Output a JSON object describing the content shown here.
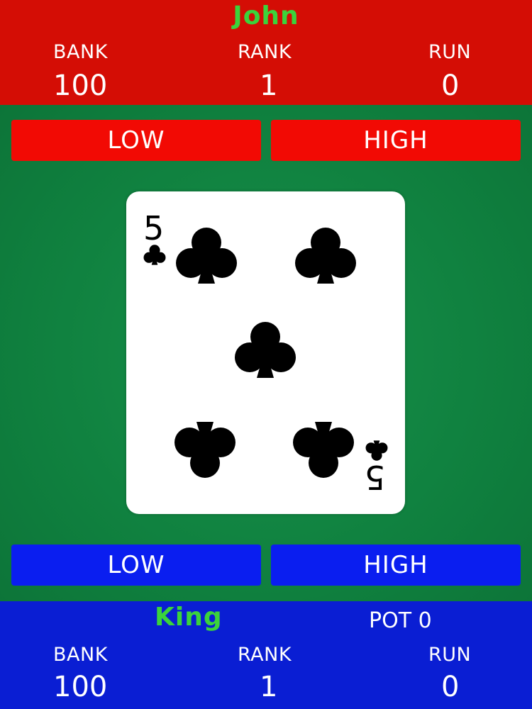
{
  "top_player": {
    "name": "John",
    "bank_label": "BANK",
    "bank_value": "100",
    "rank_label": "RANK",
    "rank_value": "1",
    "run_label": "RUN",
    "run_value": "0",
    "panel_color": "#d40d05",
    "name_color": "#3bd33b"
  },
  "top_buttons": {
    "low_label": "LOW",
    "high_label": "HIGH",
    "color": "#f20a04"
  },
  "card": {
    "rank": "5",
    "suit": "clubs",
    "suit_icon": "club-icon"
  },
  "bottom_buttons": {
    "low_label": "LOW",
    "high_label": "HIGH",
    "color": "#0a1ef0"
  },
  "bottom_player": {
    "name": "King",
    "pot_text": "POT 0",
    "bank_label": "BANK",
    "bank_value": "100",
    "rank_label": "RANK",
    "rank_value": "1",
    "run_label": "RUN",
    "run_value": "0",
    "panel_color": "#0a1ed3",
    "name_color": "#3bd33b"
  },
  "table_color": "#0f7f3e"
}
